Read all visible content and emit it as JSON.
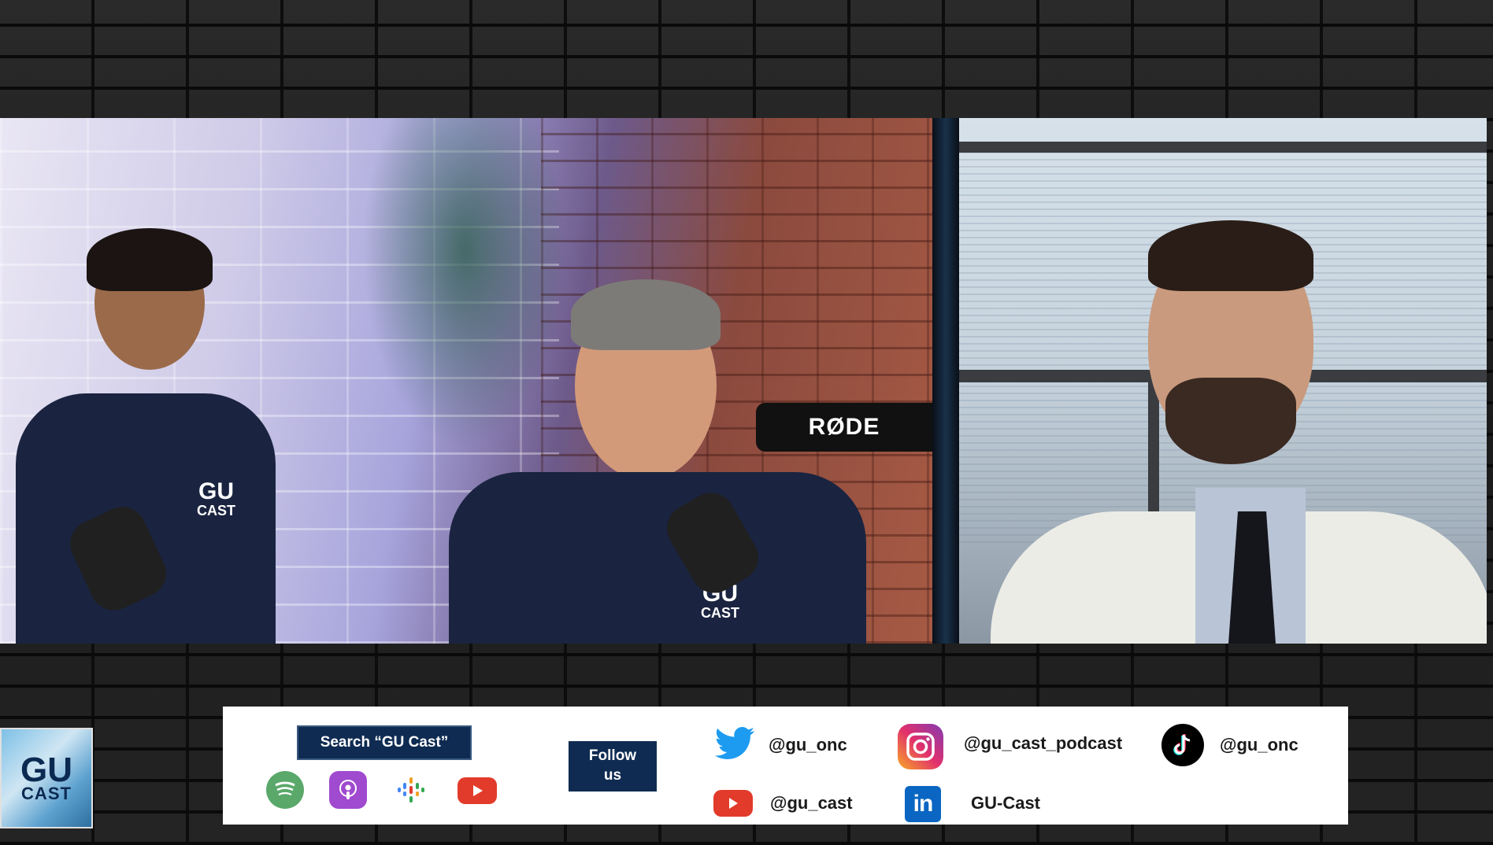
{
  "video": {
    "left_panel": {
      "shirt_logo_1": "GU",
      "shirt_logo_2": "CAST",
      "mic_brand": "RØDE"
    }
  },
  "badge": {
    "line1": "GU",
    "line2": "CAST"
  },
  "social_bar": {
    "search_label": "Search “GU Cast”",
    "follow_label_line1": "Follow",
    "follow_label_line2": "us",
    "platforms": [
      {
        "icon": "spotify-icon",
        "color": "#5aa86a"
      },
      {
        "icon": "apple-podcasts-icon",
        "color": "#a04ad0"
      },
      {
        "icon": "google-podcasts-icon",
        "color": "#f0a020"
      },
      {
        "icon": "youtube-icon",
        "color": "#e23b2b"
      }
    ],
    "handles": {
      "twitter": "@gu_onc",
      "instagram": "@gu_cast_podcast",
      "tiktok": "@gu_onc",
      "youtube": "@gu_cast",
      "linkedin": "GU-Cast"
    },
    "colors": {
      "twitter": "#1d9bf0",
      "youtube": "#e23b2b",
      "linkedin": "#0a66c2",
      "navy": "#0f2b52"
    }
  }
}
